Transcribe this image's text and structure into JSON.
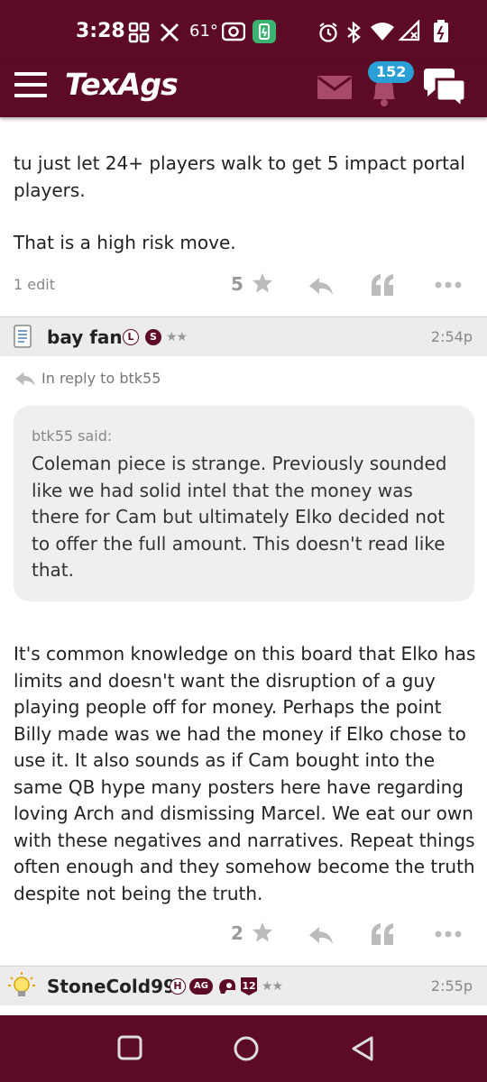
{
  "status_bar": {
    "time": "3:28",
    "temperature": "61°",
    "icons": [
      "grid-icon",
      "x-icon",
      "camera-icon",
      "battery-saver-icon",
      "alarm-icon",
      "bluetooth-icon",
      "wifi-icon",
      "signal-icon",
      "battery-icon"
    ]
  },
  "header": {
    "logo": "TexAgs",
    "notification_count": "152",
    "icons": [
      "menu-icon",
      "mail-icon",
      "bell-icon",
      "chat-icon"
    ]
  },
  "posts": [
    {
      "paragraphs": [
        "tu just let 24+ players walk to get 5 impact portal players.",
        "That is a high risk move."
      ],
      "edit_note": "1 edit",
      "rating": "5"
    },
    {
      "author": "bay fan",
      "badges": [
        "L",
        "S"
      ],
      "stars": "★★",
      "time": "2:54p",
      "reply_to": "In reply to btk55",
      "quote_author": "btk55 said:",
      "quote_text": "Coleman piece is strange. Previously sounded like we had solid intel that the money was there for Cam but ultimately Elko decided not to offer the full amount. This doesn't read like that.",
      "body": "It's common knowledge on this board that Elko has limits and doesn't want the disruption of a guy playing people off for money. Perhaps the point Billy made was we had the money if Elko chose to use it. It also sounds as if Cam bought into the same QB hype many posters here have regarding loving Arch and dismissing Marcel. We eat our own with these negatives and narratives. Repeat things often enough and they somehow become the truth despite not being the truth.",
      "rating": "2"
    },
    {
      "author": "StoneCold99",
      "badges": [
        "H",
        "AG",
        "12"
      ],
      "stars": "★★",
      "time": "2:55p"
    }
  ],
  "colors": {
    "maroon": "#5c0a25",
    "badge_blue": "#2a9fd6",
    "quote_bg": "#efefef",
    "header_bg": "#ececec"
  }
}
